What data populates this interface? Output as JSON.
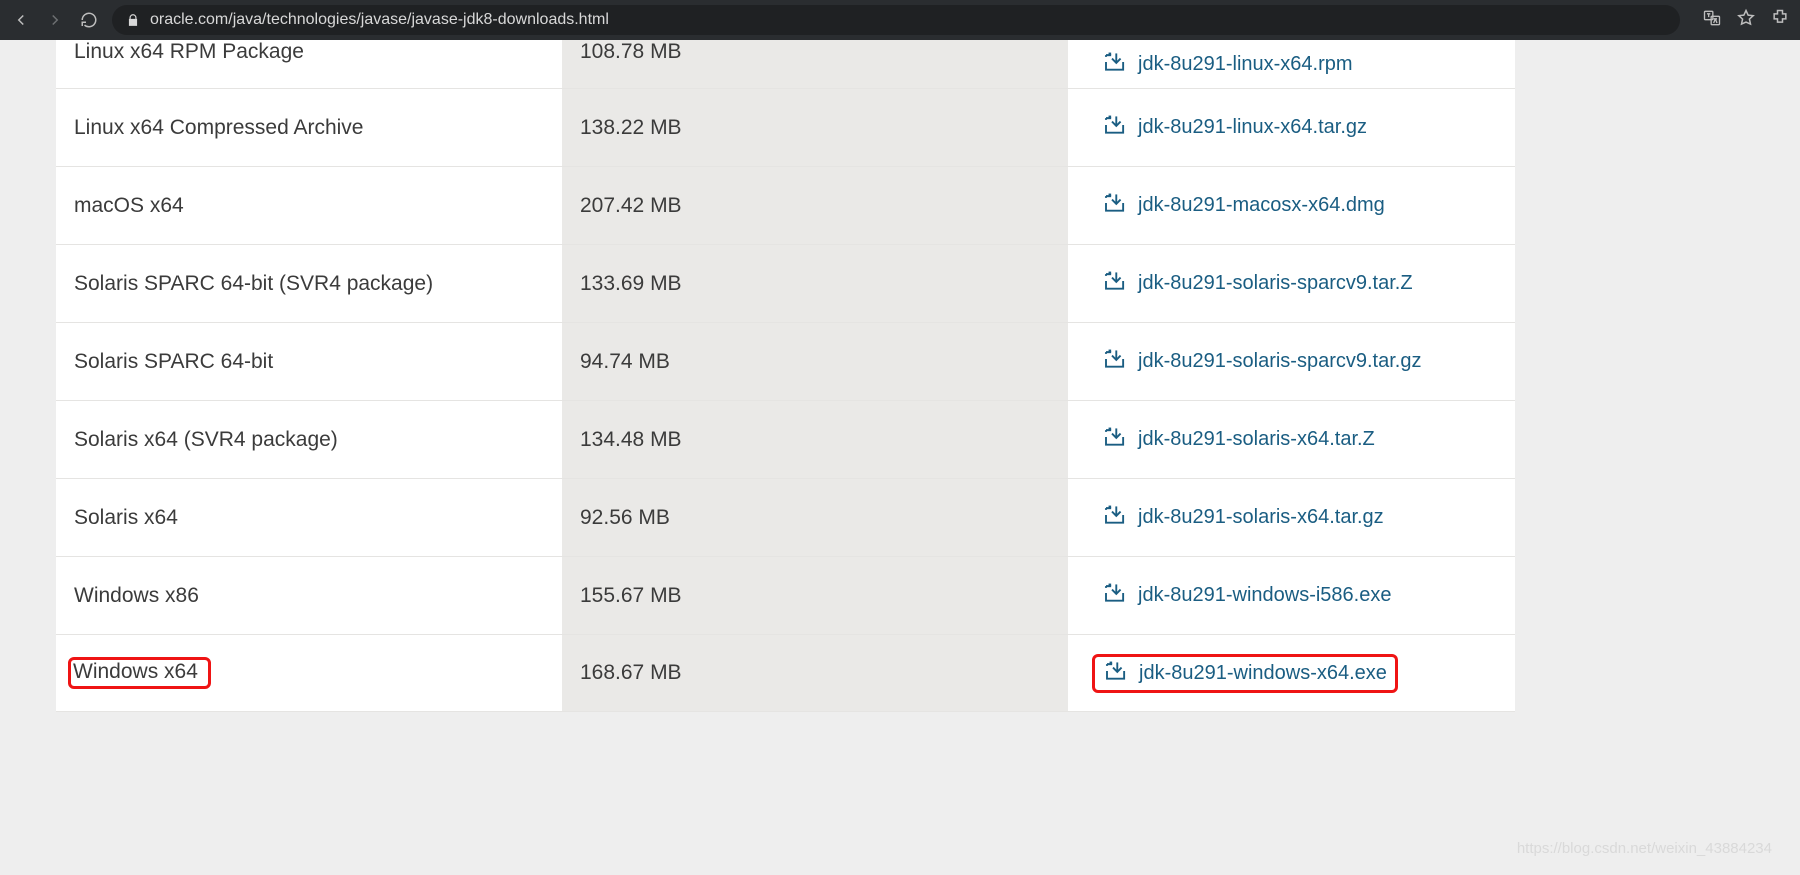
{
  "browser": {
    "url": "oracle.com/java/technologies/javase/javase-jdk8-downloads.html"
  },
  "rows": [
    {
      "name": "Linux x64 RPM Package",
      "size": "108.78 MB",
      "file": "jdk-8u291-linux-x64.rpm"
    },
    {
      "name": "Linux x64 Compressed Archive",
      "size": "138.22 MB",
      "file": "jdk-8u291-linux-x64.tar.gz"
    },
    {
      "name": "macOS x64",
      "size": "207.42 MB",
      "file": "jdk-8u291-macosx-x64.dmg"
    },
    {
      "name": "Solaris SPARC 64-bit (SVR4 package)",
      "size": "133.69 MB",
      "file": "jdk-8u291-solaris-sparcv9.tar.Z"
    },
    {
      "name": "Solaris SPARC 64-bit",
      "size": "94.74 MB",
      "file": "jdk-8u291-solaris-sparcv9.tar.gz"
    },
    {
      "name": "Solaris x64 (SVR4 package)",
      "size": "134.48 MB",
      "file": "jdk-8u291-solaris-x64.tar.Z"
    },
    {
      "name": "Solaris x64",
      "size": "92.56 MB",
      "file": "jdk-8u291-solaris-x64.tar.gz"
    },
    {
      "name": "Windows x86",
      "size": "155.67 MB",
      "file": "jdk-8u291-windows-i586.exe"
    },
    {
      "name": "Windows x64",
      "size": "168.67 MB",
      "file": "jdk-8u291-windows-x64.exe",
      "highlighted": true
    }
  ],
  "watermark": "https://blog.csdn.net/weixin_43884234"
}
